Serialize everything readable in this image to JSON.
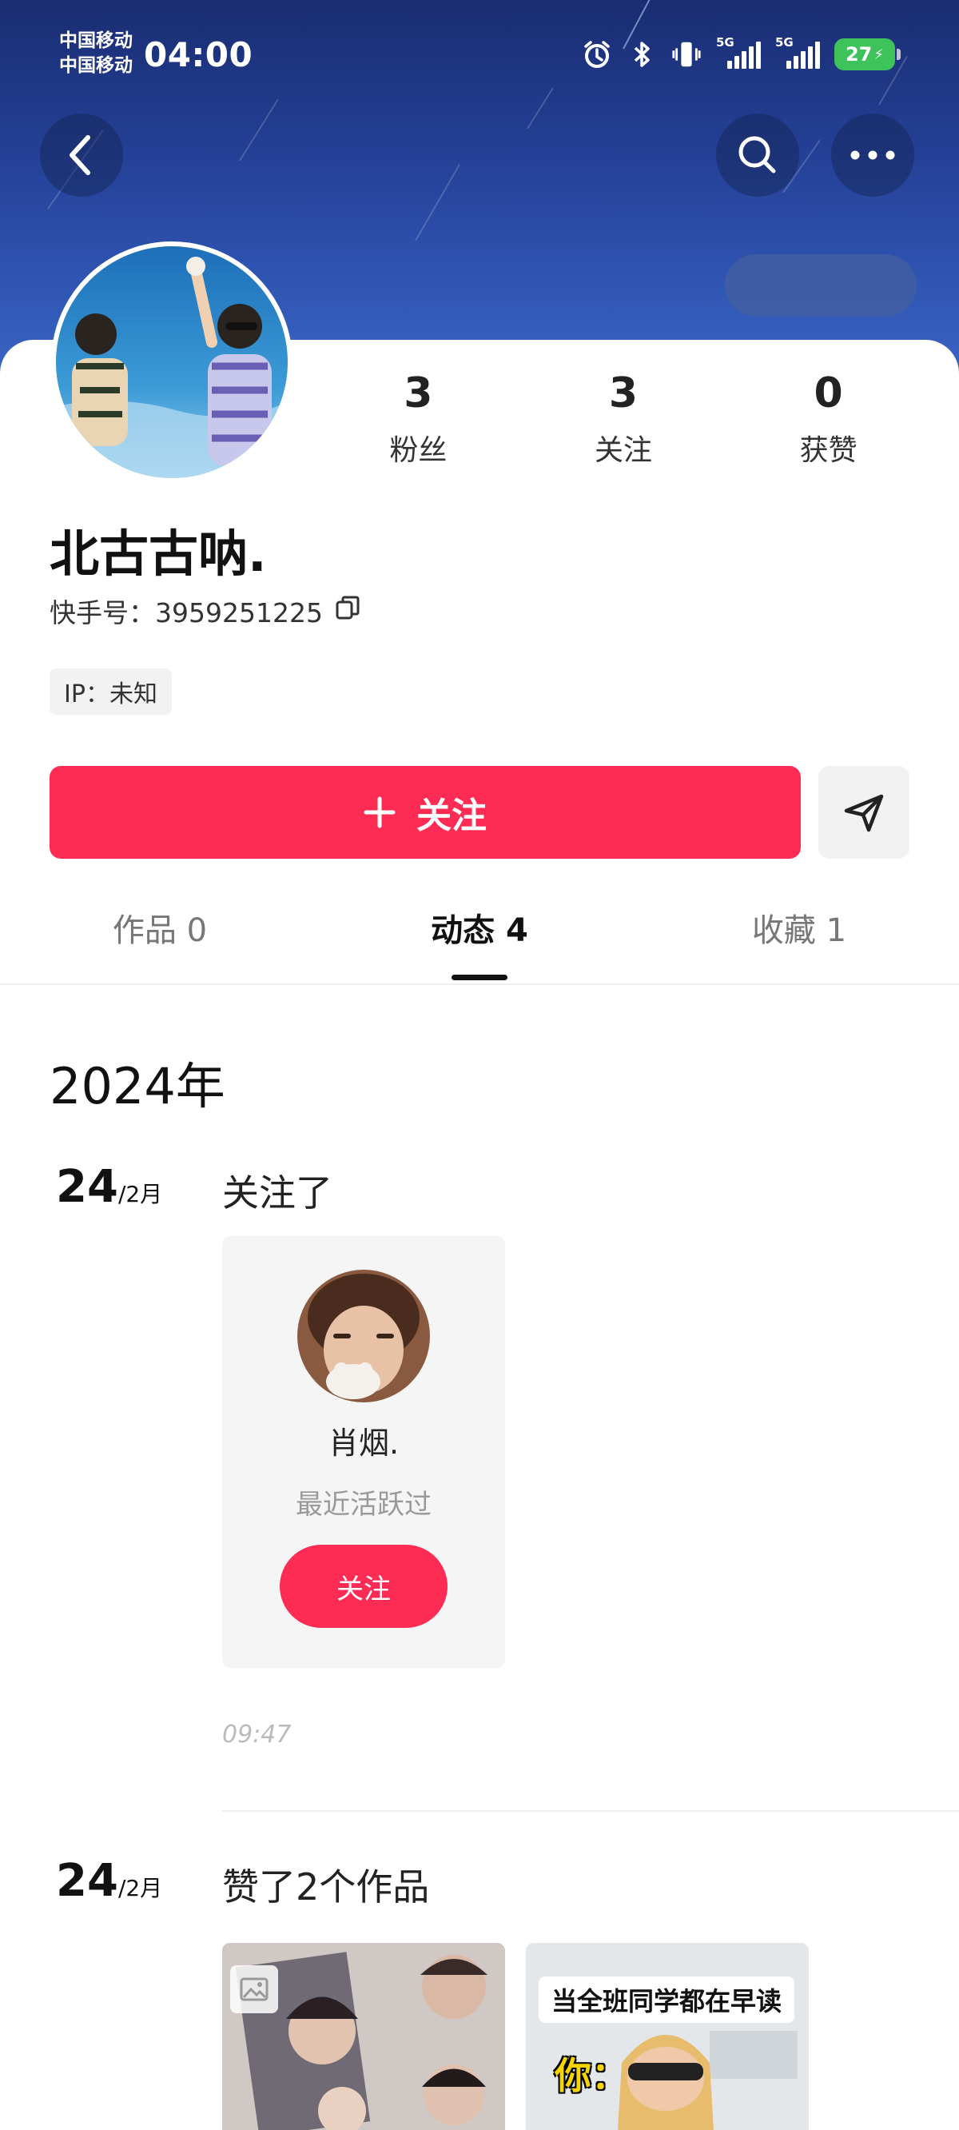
{
  "status_bar": {
    "carrier_1": "中国移动",
    "carrier_2": "中国移动",
    "time": "04:00",
    "network_1": "5G",
    "network_2": "5G",
    "battery": "27"
  },
  "header": {
    "back_icon": "chevron-left-icon",
    "search_icon": "search-icon",
    "more_icon": "more-horizontal-icon"
  },
  "profile": {
    "name": "北古古呐.",
    "uid_label": "快手号：",
    "uid": "3959251225",
    "ip": "IP：未知",
    "stats": [
      {
        "num": "3",
        "label": "粉丝"
      },
      {
        "num": "3",
        "label": "关注"
      },
      {
        "num": "0",
        "label": "获赞"
      }
    ]
  },
  "actions": {
    "follow": "关注",
    "share_icon": "send-icon"
  },
  "tabs": [
    {
      "label": "作品 0"
    },
    {
      "label": "动态 4"
    },
    {
      "label": "收藏 1"
    }
  ],
  "feed": {
    "year": "2024年",
    "entry_1": {
      "day": "24",
      "month": "/2月",
      "title": "关注了",
      "user_name": "肖烟.",
      "user_status": "最近活跃过",
      "follow_button": "关注",
      "time": "09:47"
    },
    "entry_2": {
      "day": "24",
      "month": "/2月",
      "title": "赞了2个作品",
      "thumb_2_caption": "当全班同学都在早读",
      "thumb_2_overlay": "你："
    }
  },
  "colors": {
    "accent": "#fe2c55",
    "banner": "#243f95",
    "battery": "#3ec25a"
  }
}
